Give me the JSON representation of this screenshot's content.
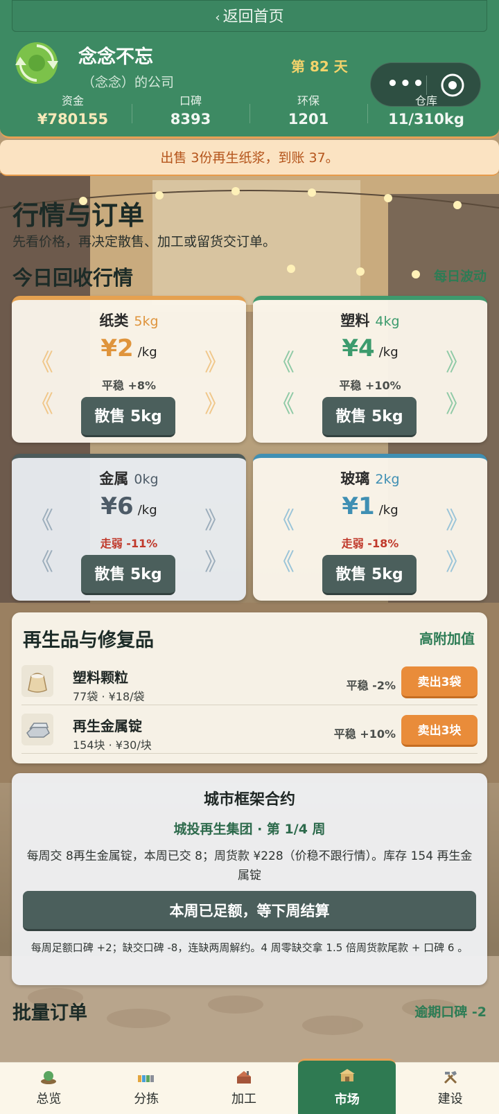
{
  "header": {
    "back_label": "返回首页",
    "company_name": "念念不忘",
    "company_owner": "（念念）的公司",
    "day_label": "第 82 天",
    "stats": [
      {
        "label": "资金",
        "value": "¥780155"
      },
      {
        "label": "口碑",
        "value": "8393"
      },
      {
        "label": "环保",
        "value": "1201"
      },
      {
        "label": "仓库",
        "value": "11/310kg"
      }
    ]
  },
  "toast": "出售 3份再生纸浆，到账 37。",
  "page": {
    "title": "行情与订单",
    "subtitle": "先看价格，再决定散售、加工或留货交订单。"
  },
  "market": {
    "title": "今日回收行情",
    "tag": "每日波动",
    "cards": [
      {
        "name": "纸类",
        "qty": "5kg",
        "price": "¥2",
        "unit": "/kg",
        "trend": "平稳 +8%",
        "button": "散售 5kg"
      },
      {
        "name": "塑料",
        "qty": "4kg",
        "price": "¥4",
        "unit": "/kg",
        "trend": "平稳 +10%",
        "button": "散售 5kg"
      },
      {
        "name": "金属",
        "qty": "0kg",
        "price": "¥6",
        "unit": "/kg",
        "trend": "走弱 -11%",
        "button": "散售 5kg"
      },
      {
        "name": "玻璃",
        "qty": "2kg",
        "price": "¥1",
        "unit": "/kg",
        "trend": "走弱 -18%",
        "button": "散售 5kg"
      }
    ],
    "arrow_left": "《",
    "arrow_right": "》"
  },
  "goods": {
    "title": "再生品与修复品",
    "tag": "高附加值",
    "items": [
      {
        "name": "塑料颗粒",
        "meta": "77袋 · ¥18/袋",
        "trend": "平稳 -2%",
        "button": "卖出3袋",
        "icon": "sack-icon"
      },
      {
        "name": "再生金属锭",
        "meta": "154块 · ¥30/块",
        "trend": "平稳 +10%",
        "button": "卖出3块",
        "icon": "ingot-icon"
      }
    ]
  },
  "contract": {
    "title": "城市框架合约",
    "client": "城投再生集团 · 第 1/4 周",
    "desc": "每周交 8再生金属锭，本周已交 8；周货款 ¥228（价稳不跟行情）。库存 154 再生金属锭",
    "button": "本周已足额，等下周结算",
    "note": "每周足额口碑 +2；缺交口碑 -8，连缺两周解约。4 周零缺交拿 1.5 倍周货款尾款 + 口碑 6 。"
  },
  "batch": {
    "title": "批量订单",
    "tag": "逾期口碑 -2"
  },
  "nav": {
    "items": [
      {
        "label": "总览",
        "icon": "overview-icon"
      },
      {
        "label": "分拣",
        "icon": "sorting-icon"
      },
      {
        "label": "加工",
        "icon": "processing-icon"
      },
      {
        "label": "市场",
        "icon": "market-icon",
        "active": true
      },
      {
        "label": "建设",
        "icon": "build-icon"
      }
    ]
  },
  "colors": {
    "header_green": "#3d8a63",
    "accent_orange": "#e98c3a",
    "button_slate": "#4b5f5c",
    "trend_down": "#c0392b"
  }
}
